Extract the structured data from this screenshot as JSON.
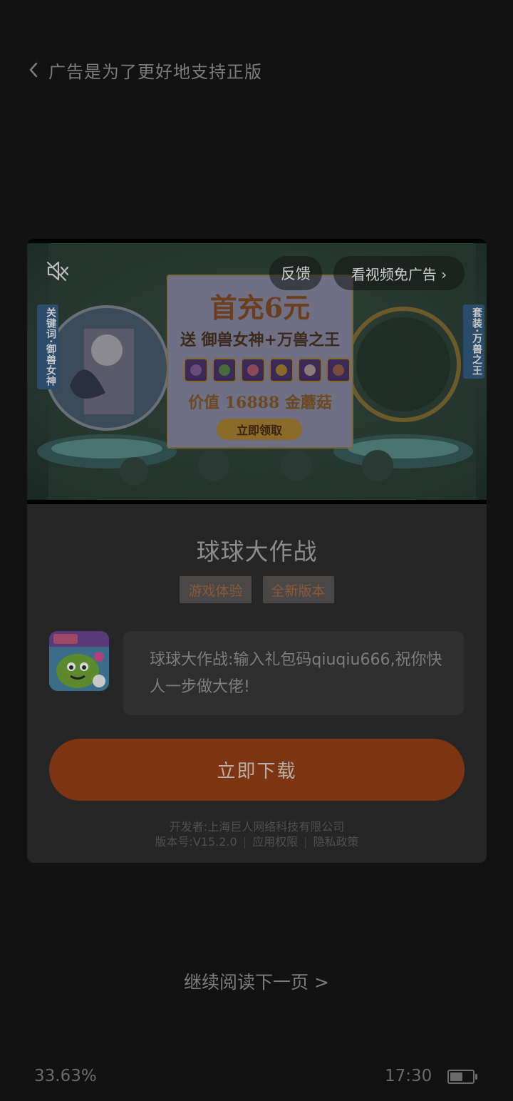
{
  "header": {
    "title": "广告是为了更好地支持正版"
  },
  "ad": {
    "feedback_label": "反馈",
    "skip_label": "看视频免广告 ›",
    "promo": {
      "headline": "首充6元",
      "subline": "送 御兽女神+万兽之王",
      "value_text": "价值 16888 金蘑菇",
      "claim_label": "立即领取",
      "left_tag": "关键词·御兽女神",
      "right_tag": "套装·万兽之王"
    }
  },
  "app": {
    "name": "球球大作战",
    "tags": [
      "游戏体验",
      "全新版本"
    ],
    "description": "球球大作战:输入礼包码qiuqiu666,祝你快人一步做大佬!",
    "download_label": "立即下载",
    "developer": "开发者:上海巨人网络科技有限公司",
    "version": "版本号:V15.2.0",
    "permissions_label": "应用权限",
    "privacy_label": "隐私政策"
  },
  "reader": {
    "next_page_label": "继续阅读下一页 >"
  },
  "status": {
    "progress": "33.63%",
    "time": "17:30",
    "battery_level": 0.55
  },
  "colors": {
    "background": "#121212",
    "card": "#262626",
    "download_button": "#7e3513"
  }
}
